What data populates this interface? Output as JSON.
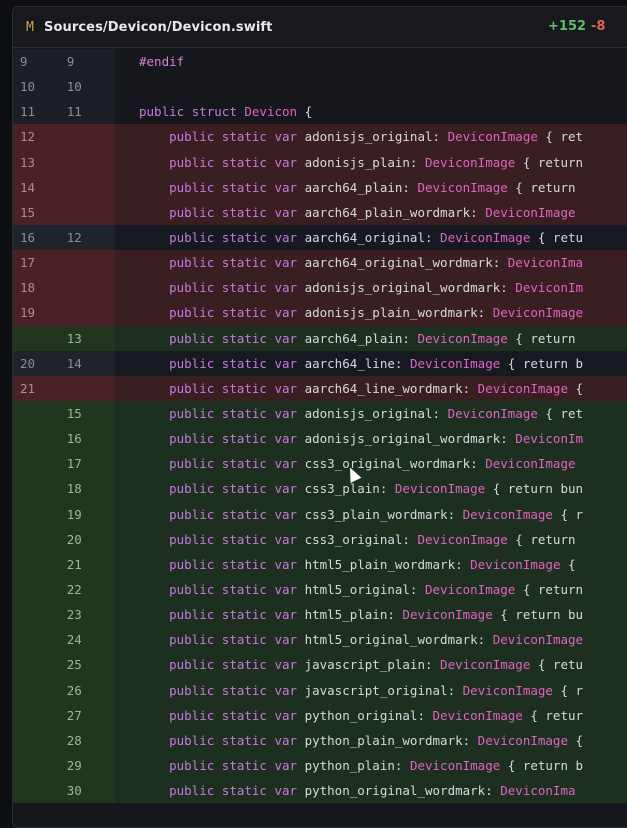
{
  "file": {
    "status": "M",
    "path": "Sources/Devicon/Devicon.swift",
    "additions": "+152",
    "deletions": "-8"
  },
  "lines": [
    {
      "type": "ctx",
      "old": "9",
      "new": "9",
      "parts": [
        {
          "c": "pp",
          "t": "#endif"
        }
      ]
    },
    {
      "type": "ctx",
      "old": "10",
      "new": "10",
      "parts": []
    },
    {
      "type": "ctx",
      "old": "11",
      "new": "11",
      "parts": [
        {
          "c": "kw",
          "t": "public "
        },
        {
          "c": "kw",
          "t": "struct "
        },
        {
          "c": "ty",
          "t": "Devicon"
        },
        {
          "c": "pl",
          "t": " {"
        }
      ]
    },
    {
      "type": "del",
      "old": "12",
      "new": "",
      "parts": [
        {
          "c": "pl",
          "t": "    "
        },
        {
          "c": "kw",
          "t": "public static var "
        },
        {
          "c": "pl",
          "t": "adonisjs_original: "
        },
        {
          "c": "ty",
          "t": "DeviconImage"
        },
        {
          "c": "pl",
          "t": " { ret"
        }
      ]
    },
    {
      "type": "del",
      "old": "13",
      "new": "",
      "parts": [
        {
          "c": "pl",
          "t": "    "
        },
        {
          "c": "kw",
          "t": "public static var "
        },
        {
          "c": "pl",
          "t": "adonisjs_plain: "
        },
        {
          "c": "ty",
          "t": "DeviconImage"
        },
        {
          "c": "pl",
          "t": " { return"
        }
      ]
    },
    {
      "type": "del",
      "old": "14",
      "new": "",
      "parts": [
        {
          "c": "pl",
          "t": "    "
        },
        {
          "c": "kw",
          "t": "public static var "
        },
        {
          "c": "pl",
          "t": "aarch64_plain: "
        },
        {
          "c": "ty",
          "t": "DeviconImage"
        },
        {
          "c": "pl",
          "t": " { return"
        }
      ]
    },
    {
      "type": "del",
      "old": "15",
      "new": "",
      "parts": [
        {
          "c": "pl",
          "t": "    "
        },
        {
          "c": "kw",
          "t": "public static var "
        },
        {
          "c": "pl",
          "t": "aarch64_plain_wordmark: "
        },
        {
          "c": "ty",
          "t": "DeviconImage"
        }
      ]
    },
    {
      "type": "mod",
      "old": "16",
      "new": "12",
      "parts": [
        {
          "c": "pl",
          "t": "    "
        },
        {
          "c": "kw",
          "t": "public static var "
        },
        {
          "c": "pl",
          "t": "aarch64_original: "
        },
        {
          "c": "ty",
          "t": "DeviconImage"
        },
        {
          "c": "pl",
          "t": " { retu"
        }
      ]
    },
    {
      "type": "del",
      "old": "17",
      "new": "",
      "parts": [
        {
          "c": "pl",
          "t": "    "
        },
        {
          "c": "kw",
          "t": "public static var "
        },
        {
          "c": "pl",
          "t": "aarch64_original_wordmark: "
        },
        {
          "c": "ty",
          "t": "DeviconIma"
        }
      ]
    },
    {
      "type": "del",
      "old": "18",
      "new": "",
      "parts": [
        {
          "c": "pl",
          "t": "    "
        },
        {
          "c": "kw",
          "t": "public static var "
        },
        {
          "c": "pl",
          "t": "adonisjs_original_wordmark: "
        },
        {
          "c": "ty",
          "t": "DeviconIm"
        }
      ]
    },
    {
      "type": "del",
      "old": "19",
      "new": "",
      "parts": [
        {
          "c": "pl",
          "t": "    "
        },
        {
          "c": "kw",
          "t": "public static var "
        },
        {
          "c": "pl",
          "t": "adonisjs_plain_wordmark: "
        },
        {
          "c": "ty",
          "t": "DeviconImage"
        }
      ]
    },
    {
      "type": "add",
      "old": "",
      "new": "13",
      "parts": [
        {
          "c": "pl",
          "t": "    "
        },
        {
          "c": "kw",
          "t": "public static var "
        },
        {
          "c": "pl",
          "t": "aarch64_plain: "
        },
        {
          "c": "ty",
          "t": "DeviconImage"
        },
        {
          "c": "pl",
          "t": " { return"
        }
      ]
    },
    {
      "type": "mod",
      "old": "20",
      "new": "14",
      "parts": [
        {
          "c": "pl",
          "t": "    "
        },
        {
          "c": "kw",
          "t": "public static var "
        },
        {
          "c": "pl",
          "t": "aarch64_line: "
        },
        {
          "c": "ty",
          "t": "DeviconImage"
        },
        {
          "c": "pl",
          "t": " { return b"
        }
      ]
    },
    {
      "type": "del",
      "old": "21",
      "new": "",
      "parts": [
        {
          "c": "pl",
          "t": "    "
        },
        {
          "c": "kw",
          "t": "public static var "
        },
        {
          "c": "pl",
          "t": "aarch64_line_wordmark: "
        },
        {
          "c": "ty",
          "t": "DeviconImage"
        },
        {
          "c": "pl",
          "t": " {"
        }
      ]
    },
    {
      "type": "add",
      "old": "",
      "new": "15",
      "parts": [
        {
          "c": "pl",
          "t": "    "
        },
        {
          "c": "kw",
          "t": "public static var "
        },
        {
          "c": "pl",
          "t": "adonisjs_original: "
        },
        {
          "c": "ty",
          "t": "DeviconImage"
        },
        {
          "c": "pl",
          "t": " { ret"
        }
      ]
    },
    {
      "type": "add",
      "old": "",
      "new": "16",
      "parts": [
        {
          "c": "pl",
          "t": "    "
        },
        {
          "c": "kw",
          "t": "public static var "
        },
        {
          "c": "pl",
          "t": "adonisjs_original_wordmark: "
        },
        {
          "c": "ty",
          "t": "DeviconIm"
        }
      ]
    },
    {
      "type": "add",
      "old": "",
      "new": "17",
      "parts": [
        {
          "c": "pl",
          "t": "    "
        },
        {
          "c": "kw",
          "t": "public static var "
        },
        {
          "c": "pl",
          "t": "css3_original_wordmark: "
        },
        {
          "c": "ty",
          "t": "DeviconImage"
        }
      ]
    },
    {
      "type": "add",
      "old": "",
      "new": "18",
      "parts": [
        {
          "c": "pl",
          "t": "    "
        },
        {
          "c": "kw",
          "t": "public static var "
        },
        {
          "c": "pl",
          "t": "css3_plain: "
        },
        {
          "c": "ty",
          "t": "DeviconImage"
        },
        {
          "c": "pl",
          "t": " { return bun"
        }
      ]
    },
    {
      "type": "add",
      "old": "",
      "new": "19",
      "parts": [
        {
          "c": "pl",
          "t": "    "
        },
        {
          "c": "kw",
          "t": "public static var "
        },
        {
          "c": "pl",
          "t": "css3_plain_wordmark: "
        },
        {
          "c": "ty",
          "t": "DeviconImage"
        },
        {
          "c": "pl",
          "t": " { r"
        }
      ]
    },
    {
      "type": "add",
      "old": "",
      "new": "20",
      "parts": [
        {
          "c": "pl",
          "t": "    "
        },
        {
          "c": "kw",
          "t": "public static var "
        },
        {
          "c": "pl",
          "t": "css3_original: "
        },
        {
          "c": "ty",
          "t": "DeviconImage"
        },
        {
          "c": "pl",
          "t": " { return"
        }
      ]
    },
    {
      "type": "add",
      "old": "",
      "new": "21",
      "parts": [
        {
          "c": "pl",
          "t": "    "
        },
        {
          "c": "kw",
          "t": "public static var "
        },
        {
          "c": "pl",
          "t": "html5_plain_wordmark: "
        },
        {
          "c": "ty",
          "t": "DeviconImage"
        },
        {
          "c": "pl",
          "t": " {"
        }
      ]
    },
    {
      "type": "add",
      "old": "",
      "new": "22",
      "parts": [
        {
          "c": "pl",
          "t": "    "
        },
        {
          "c": "kw",
          "t": "public static var "
        },
        {
          "c": "pl",
          "t": "html5_original: "
        },
        {
          "c": "ty",
          "t": "DeviconImage"
        },
        {
          "c": "pl",
          "t": " { return"
        }
      ]
    },
    {
      "type": "add",
      "old": "",
      "new": "23",
      "parts": [
        {
          "c": "pl",
          "t": "    "
        },
        {
          "c": "kw",
          "t": "public static var "
        },
        {
          "c": "pl",
          "t": "html5_plain: "
        },
        {
          "c": "ty",
          "t": "DeviconImage"
        },
        {
          "c": "pl",
          "t": " { return bu"
        }
      ]
    },
    {
      "type": "add",
      "old": "",
      "new": "24",
      "parts": [
        {
          "c": "pl",
          "t": "    "
        },
        {
          "c": "kw",
          "t": "public static var "
        },
        {
          "c": "pl",
          "t": "html5_original_wordmark: "
        },
        {
          "c": "ty",
          "t": "DeviconImage"
        }
      ]
    },
    {
      "type": "add",
      "old": "",
      "new": "25",
      "parts": [
        {
          "c": "pl",
          "t": "    "
        },
        {
          "c": "kw",
          "t": "public static var "
        },
        {
          "c": "pl",
          "t": "javascript_plain: "
        },
        {
          "c": "ty",
          "t": "DeviconImage"
        },
        {
          "c": "pl",
          "t": " { retu"
        }
      ]
    },
    {
      "type": "add",
      "old": "",
      "new": "26",
      "parts": [
        {
          "c": "pl",
          "t": "    "
        },
        {
          "c": "kw",
          "t": "public static var "
        },
        {
          "c": "pl",
          "t": "javascript_original: "
        },
        {
          "c": "ty",
          "t": "DeviconImage"
        },
        {
          "c": "pl",
          "t": " { r"
        }
      ]
    },
    {
      "type": "add",
      "old": "",
      "new": "27",
      "parts": [
        {
          "c": "pl",
          "t": "    "
        },
        {
          "c": "kw",
          "t": "public static var "
        },
        {
          "c": "pl",
          "t": "python_original: "
        },
        {
          "c": "ty",
          "t": "DeviconImage"
        },
        {
          "c": "pl",
          "t": " { retur"
        }
      ]
    },
    {
      "type": "add",
      "old": "",
      "new": "28",
      "parts": [
        {
          "c": "pl",
          "t": "    "
        },
        {
          "c": "kw",
          "t": "public static var "
        },
        {
          "c": "pl",
          "t": "python_plain_wordmark: "
        },
        {
          "c": "ty",
          "t": "DeviconImage"
        },
        {
          "c": "pl",
          "t": " {"
        }
      ]
    },
    {
      "type": "add",
      "old": "",
      "new": "29",
      "parts": [
        {
          "c": "pl",
          "t": "    "
        },
        {
          "c": "kw",
          "t": "public static var "
        },
        {
          "c": "pl",
          "t": "python_plain: "
        },
        {
          "c": "ty",
          "t": "DeviconImage"
        },
        {
          "c": "pl",
          "t": " { return b"
        }
      ]
    },
    {
      "type": "add",
      "old": "",
      "new": "30",
      "parts": [
        {
          "c": "pl",
          "t": "    "
        },
        {
          "c": "kw",
          "t": "public static var "
        },
        {
          "c": "pl",
          "t": "python_original_wordmark: "
        },
        {
          "c": "ty",
          "t": "DeviconIma"
        }
      ]
    }
  ]
}
